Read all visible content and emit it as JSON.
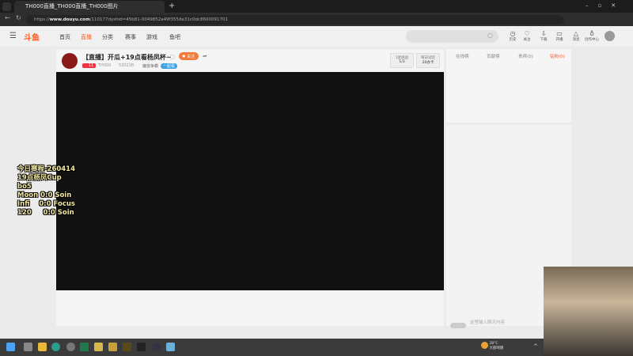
{
  "browser": {
    "tab_title": "TH000直播_TH000直播_TH000图片",
    "url_prefix": "https://",
    "url_domain": "www.douyu.com",
    "url_rest": "/110177dyshid=45b81-0049852a49f355de31c0dc8600091701"
  },
  "site": {
    "logo": "斗鱼",
    "nav": [
      "首页",
      "直播",
      "分类",
      "赛事",
      "游戏",
      "鱼吧"
    ],
    "active_nav": "直播",
    "accent": "#ff5d23",
    "toolbar": [
      {
        "icon": "history-icon",
        "label": "历史"
      },
      {
        "icon": "heart-icon",
        "label": "关注"
      },
      {
        "icon": "download-icon",
        "label": "下载"
      },
      {
        "icon": "broadcast-icon",
        "label": "开播"
      },
      {
        "icon": "bell-icon",
        "label": "消息"
      },
      {
        "icon": "bulb-icon",
        "label": "创作中心"
      }
    ]
  },
  "room": {
    "title": "【直播】开瓜+19点看杨凤杯~",
    "follow_label": "关注",
    "level": "11",
    "streamer": "TH000",
    "popularity": "530238",
    "category": "魔兽争霸",
    "tag": "一起看",
    "quest_label": "1星挑战",
    "quest_value": "1/3",
    "daily_label": "每日试玩",
    "daily_value": "20办卡"
  },
  "overlay_lines": [
    "今日赛程-260414",
    "19点杨凤Cup",
    "bo5",
    "Moon 0:0 Soin",
    "Infi    0:0 Focus",
    "120     0:0 Soin"
  ],
  "ranking_tabs": [
    "在线榜",
    "贡献榜",
    "贵宾(0)",
    "钻粉(0)"
  ],
  "chat": {
    "placeholder": "这里输入聊天内容"
  },
  "taskbar": {
    "weather_temp": "28°C",
    "weather_desc": "大部晴朗"
  }
}
